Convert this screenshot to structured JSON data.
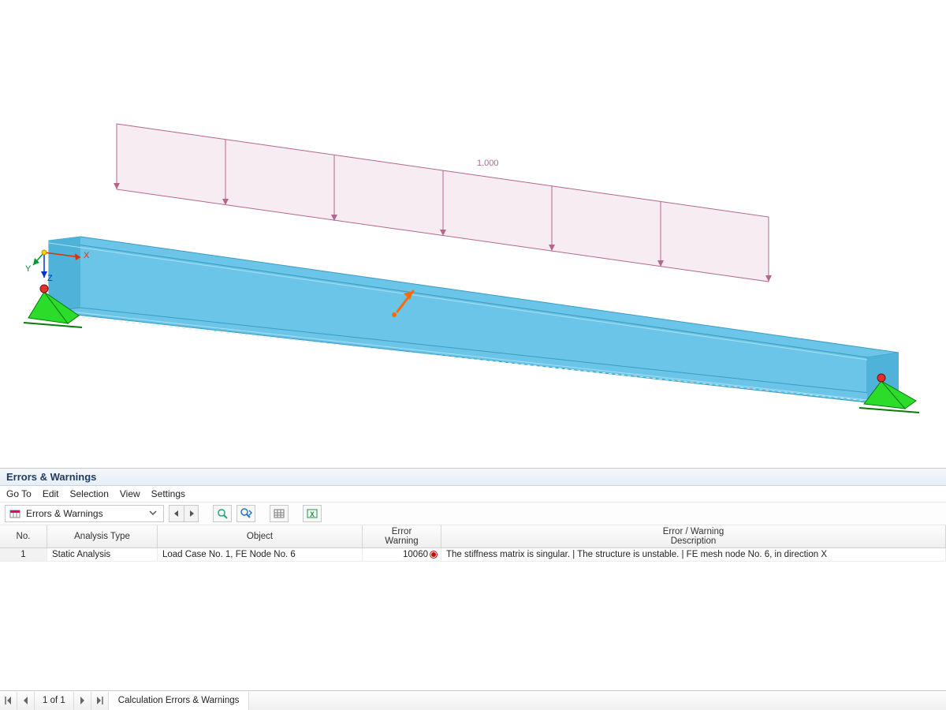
{
  "viewport": {
    "load_value_label": "1.000",
    "axis_labels": {
      "x": "X",
      "y": "Y",
      "z": "Z"
    }
  },
  "panel": {
    "title": "Errors & Warnings",
    "menu": [
      "Go To",
      "Edit",
      "Selection",
      "View",
      "Settings"
    ],
    "dropdown_label": "Errors & Warnings",
    "columns": {
      "no": "No.",
      "analysis_type": "Analysis Type",
      "object": "Object",
      "error_warning_top": "Error",
      "error_warning_bottom": "Warning",
      "description_top": "Error / Warning",
      "description_bottom": "Description"
    },
    "rows": [
      {
        "no": "1",
        "analysis_type": "Static Analysis",
        "object": "Load Case No. 1, FE Node No. 6",
        "error_code": "10060",
        "description": "The stiffness matrix is singular. |  The structure is unstable. | FE mesh node No. 6, in direction X"
      }
    ]
  },
  "pager": {
    "page_info": "1 of 1",
    "tab_label": "Calculation Errors & Warnings"
  }
}
